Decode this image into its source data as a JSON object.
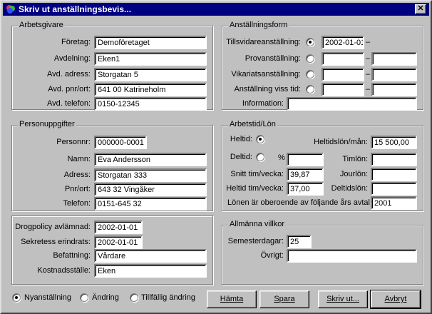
{
  "window": {
    "title": "Skriv ut anställningsbevis..."
  },
  "arbetsgivare": {
    "legend": "Arbetsgivare",
    "foretag": {
      "label": "Företag:",
      "value": "Demoföretaget"
    },
    "avdelning": {
      "label": "Avdelning:",
      "value": "Eken1"
    },
    "adress": {
      "label": "Avd. adress:",
      "value": "Storgatan 5"
    },
    "pnr_ort": {
      "label": "Avd. pnr/ort:",
      "value": "641 00 Katrineholm"
    },
    "telefon": {
      "label": "Avd. telefon:",
      "value": "0150-12345"
    }
  },
  "anstallningsform": {
    "legend": "Anställningsform",
    "tillsvidare": {
      "label": "Tillsvidareanställning:",
      "from": "2002-01-01",
      "selected": true
    },
    "prov": {
      "label": "Provanställning:",
      "from": "",
      "to": ""
    },
    "vikariat": {
      "label": "Vikariatsanställning:",
      "from": "",
      "to": ""
    },
    "viss_tid": {
      "label": "Anställning viss tid:",
      "from": "",
      "to": ""
    },
    "information": {
      "label": "Information:",
      "value": ""
    },
    "dash": "–"
  },
  "personuppgifter": {
    "legend": "Personuppgifter",
    "personnr": {
      "label": "Personnr:",
      "value": "000000-0001"
    },
    "namn": {
      "label": "Namn:",
      "value": "Eva Andersson"
    },
    "adress": {
      "label": "Adress:",
      "value": "Storgatan 333"
    },
    "pnr_ort": {
      "label": "Pnr/ort:",
      "value": "643 32  Vingåker"
    },
    "telefon": {
      "label": "Telefon:",
      "value": "0151-645 32"
    }
  },
  "arbetstid": {
    "legend": "Arbetstid/Lön",
    "heltid": {
      "label": "Heltid:",
      "selected": true
    },
    "deltid": {
      "label": "Deltid:",
      "percent_label": "%",
      "percent": ""
    },
    "snitt": {
      "label": "Snitt tim/vecka:",
      "value": "39,87"
    },
    "heltid_tim": {
      "label": "Heltid tim/vecka:",
      "value": "37,00"
    },
    "heltidslon": {
      "label": "Heltidslön/mån:",
      "value": "15 500,00"
    },
    "timlon": {
      "label": "Timlön:",
      "value": ""
    },
    "jourlon": {
      "label": "Jourlön:",
      "value": ""
    },
    "deltidslon": {
      "label": "Deltidslön:",
      "value": ""
    },
    "avtal": {
      "label": "Lönen är oberoende av följande års avtal:",
      "value": "2001"
    }
  },
  "ovrigt_grupp": {
    "drogpolicy": {
      "label": "Drogpolicy avlämnad:",
      "value": "2002-01-01"
    },
    "sekretess": {
      "label": "Sekretess erindrats:",
      "value": "2002-01-01"
    },
    "befattning": {
      "label": "Befattning:",
      "value": "Vårdare"
    },
    "kostnadsstalle": {
      "label": "Kostnadsställe:",
      "value": "Eken"
    }
  },
  "villkor": {
    "legend": "Allmänna villkor",
    "semesterdagar": {
      "label": "Semesterdagar:",
      "value": "25"
    },
    "ovrigt": {
      "label": "Övrigt:",
      "value": ""
    }
  },
  "footer": {
    "nyanstallning": "Nyanställning",
    "andring": "Ändring",
    "tillfallig": "Tillfällig ändring",
    "selected": "nyanstallning",
    "hamta": "Hämta",
    "spara": "Spara",
    "skriv_ut": "Skriv ut...",
    "avbryt": "Avbryt"
  },
  "colors": {
    "titlebar": "#000080",
    "face": "#c0c0c0"
  },
  "icons": {
    "app": "app-logo-icon",
    "close": "close-icon"
  }
}
